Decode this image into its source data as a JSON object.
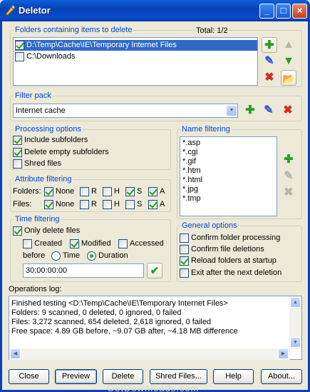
{
  "window": {
    "title": "Deletor"
  },
  "folders": {
    "legend": "Folders containing items to delete",
    "total": "Total: 1/2",
    "items": [
      {
        "path": "D:\\Temp\\Cache\\IE\\Temporary Internet Files",
        "checked": true
      },
      {
        "path": "C:\\Downloads",
        "checked": false
      }
    ]
  },
  "filter_pack": {
    "legend": "Filter pack",
    "value": "Internet cache"
  },
  "processing": {
    "legend": "Processing options",
    "include": "Include subfolders",
    "delete_empty": "Delete empty subfolders",
    "shred": "Shred files"
  },
  "name_filtering": {
    "legend": "Name filtering",
    "patterns": [
      "*.asp",
      "*.cgi",
      "*.gif",
      "*.htm",
      "*.html",
      "*.jpg",
      "*.tmp"
    ]
  },
  "attribute": {
    "legend": "Attribute filtering",
    "folders_label": "Folders:",
    "files_label": "Files:",
    "none": "None",
    "r": "R",
    "h": "H",
    "s": "S",
    "a": "A"
  },
  "time": {
    "legend": "Time filtering",
    "only_delete": "Only delete files",
    "created": "Created",
    "modified": "Modified",
    "accessed": "Accessed",
    "before": "before",
    "time": "Time",
    "duration": "Duration",
    "value": "30:00:00:00"
  },
  "general": {
    "legend": "General options",
    "confirm_folder": "Confirm folder processing",
    "confirm_file": "Confirm file deletions",
    "reload": "Reload folders at startup",
    "exit": "Exit after the next deletion"
  },
  "log": {
    "label": "Operations log:",
    "lines": [
      "Finished testing <D:\\Temp\\Cache\\IE\\Temporary Internet Files>",
      "Folders: 9 scanned, 0 deleted, 0 ignored, 0 failed",
      "Files: 3,272 scanned, 654 deleted, 2,618 ignored, 0 failed",
      "Free space: 4.89 GB before, ~9.07 GB after, ~4.18 MB difference"
    ]
  },
  "buttons": {
    "close": "Close",
    "preview": "Preview",
    "delete": "Delete",
    "shred": "Shred Files...",
    "help": "Help",
    "about": "About..."
  },
  "watermark": "GetDownloads.com"
}
